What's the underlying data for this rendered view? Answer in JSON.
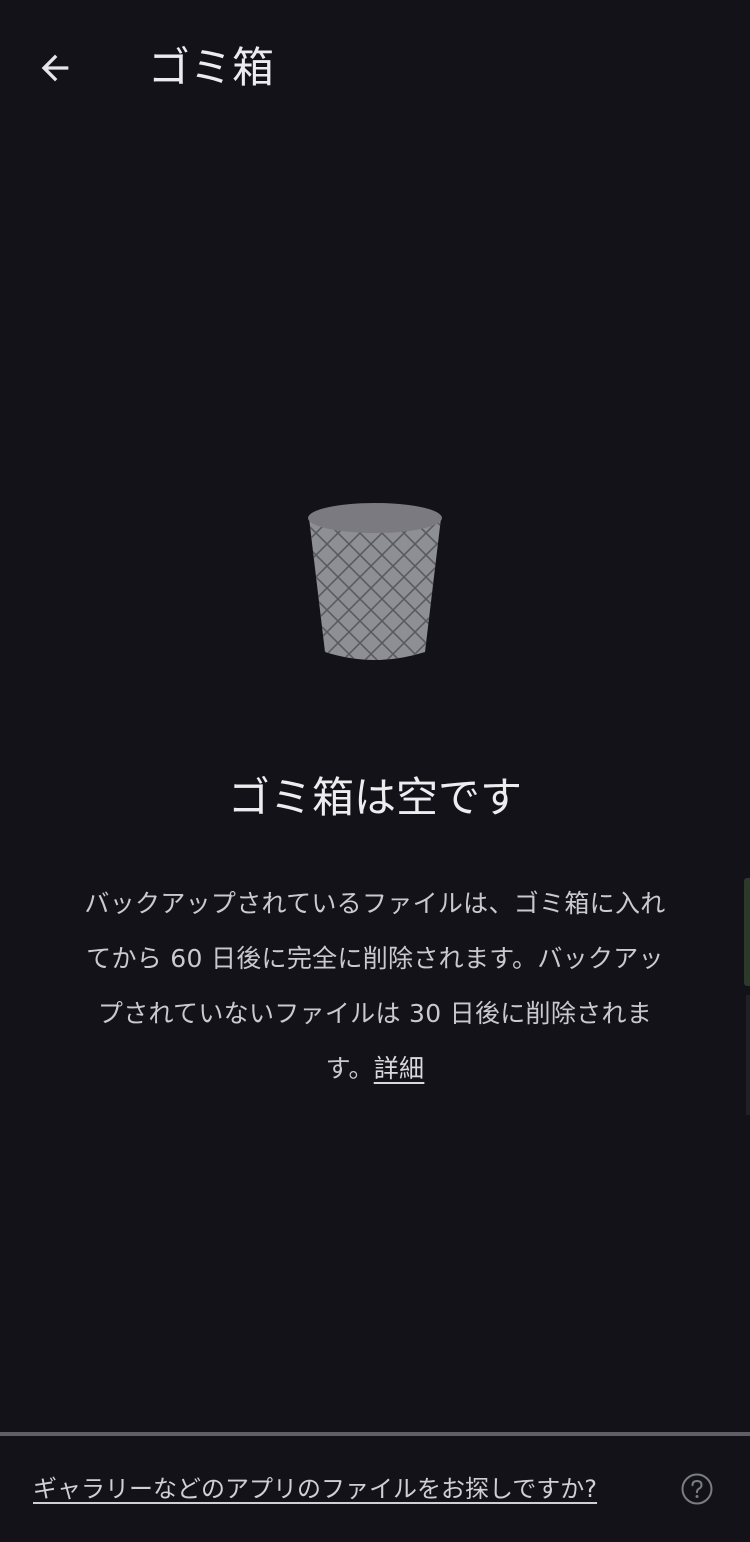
{
  "header": {
    "back_icon": "arrow-back-icon",
    "title": "ゴミ箱"
  },
  "empty_state": {
    "illustration_icon": "trash-can-icon",
    "title": "ゴミ箱は空です",
    "description": "バックアップされているファイルは、ゴミ箱に入れてから 60 日後に完全に削除されます。バックアップされていないファイルは 30 日後に削除されます。",
    "learn_more": "詳細"
  },
  "footer": {
    "link": "ギャラリーなどのアプリのファイルをお探しですか?",
    "help_icon": "help-circle-icon"
  }
}
